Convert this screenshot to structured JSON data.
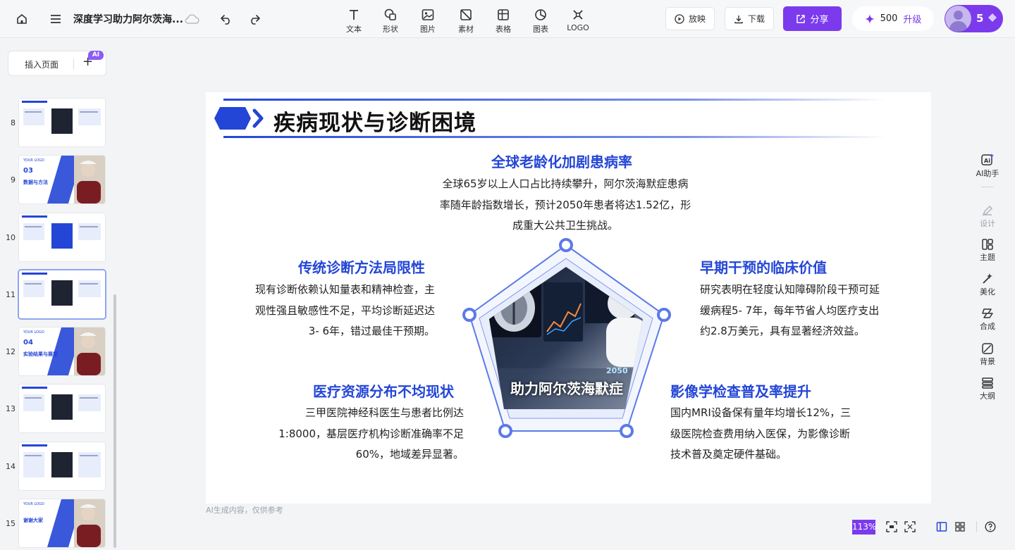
{
  "topbar": {
    "doc_title": "深度学习助力阿尔茨海...",
    "tools": [
      {
        "label": "文本",
        "icon": "text-icon"
      },
      {
        "label": "形状",
        "icon": "shape-icon"
      },
      {
        "label": "图片",
        "icon": "image-icon"
      },
      {
        "label": "素材",
        "icon": "material-icon"
      },
      {
        "label": "表格",
        "icon": "table-icon"
      },
      {
        "label": "图表",
        "icon": "chart-icon"
      },
      {
        "label": "LOGO",
        "icon": "logo-icon"
      }
    ],
    "play_label": "放映",
    "download_label": "下载",
    "share_label": "分享",
    "credits": "500",
    "upgrade_label": "升级",
    "avatar_count": "5"
  },
  "pages_panel": {
    "insert_label": "插入页面",
    "ai_badge": "AI",
    "pages": [
      {
        "num": "8",
        "layout": "diagram"
      },
      {
        "num": "9",
        "layout": "section",
        "section_no": "03",
        "section_title": "数据与方法",
        "logo": "YOUR LOGO"
      },
      {
        "num": "10",
        "layout": "cards"
      },
      {
        "num": "11",
        "layout": "list"
      },
      {
        "num": "12",
        "layout": "section",
        "section_no": "04",
        "section_title": "实验结果与展望",
        "logo": "YOUR LOGO"
      },
      {
        "num": "13",
        "layout": "diagram"
      },
      {
        "num": "14",
        "layout": "grid"
      },
      {
        "num": "15",
        "layout": "ending",
        "section_title": "谢谢大家",
        "logo": "YOUR LOGO"
      }
    ],
    "active_page": "11"
  },
  "slide": {
    "title": "疾病现状与诊断困境",
    "sections": [
      {
        "title": "全球老龄化加剧患病率",
        "text": [
          "全球65岁以上人口占比持续攀升，阿尔茨海默症患病",
          "率随年龄指数增长，预计2050年患者将达1.52亿，形",
          "成重大公共卫生挑战。"
        ]
      },
      {
        "title": "传统诊断方法局限性",
        "text": [
          "现有诊断依赖认知量表和精神检查，主",
          "观性强且敏感性不足，平均诊断延迟达",
          "3- 6年，错过最佳干预期。"
        ]
      },
      {
        "title": "早期干预的临床价值",
        "text": [
          "研究表明在轻度认知障碍阶段干预可延",
          "缓病程5- 7年，每年节省人均医疗支出",
          "约2.8万美元，具有显著经济效益。"
        ]
      },
      {
        "title": "医疗资源分布不均现状",
        "text": [
          "三甲医院神经科医生与患者比例达",
          "1:8000，基层医疗机构诊断准确率不足",
          "60%，地域差异显著。"
        ]
      },
      {
        "title": "影像学检查普及率提升",
        "text": [
          "国内MRI设备保有量年均增长12%，三",
          "级医院检查费用纳入医保，为影像诊断",
          "技术普及奠定硬件基础。"
        ]
      }
    ],
    "photo_watermark": "助力阿尔茨海默症",
    "photo_tag": "2050"
  },
  "footnote": "AI生成内容，仅供参考",
  "right_toolbar": [
    {
      "label": "AI助手",
      "icon": "ai-assistant-icon"
    },
    {
      "label": "设计",
      "icon": "design-icon"
    },
    {
      "label": "主题",
      "icon": "theme-icon"
    },
    {
      "label": "美化",
      "icon": "beautify-icon"
    },
    {
      "label": "合成",
      "icon": "compose-icon"
    },
    {
      "label": "背景",
      "icon": "background-icon"
    },
    {
      "label": "大纲",
      "icon": "outline-icon"
    }
  ],
  "bottom": {
    "zoom": "113%"
  },
  "colors": {
    "accent": "#7c3aed",
    "slide_blue": "#2446d6",
    "frame_blue": "#4f72e8"
  }
}
